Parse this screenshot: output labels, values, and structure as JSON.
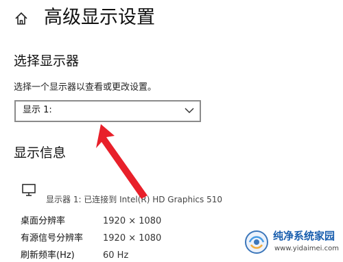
{
  "header": {
    "title": "高级显示设置"
  },
  "select_display": {
    "heading": "选择显示器",
    "description": "选择一个显示器以查看或更改设置。",
    "selected": "显示 1:"
  },
  "display_info": {
    "heading": "显示信息",
    "monitor_line": "显示器 1: 已连接到 Intel(R) HD Graphics 510",
    "rows": [
      {
        "label": "桌面分辨率",
        "value": "1920 × 1080"
      },
      {
        "label": "有源信号分辨率",
        "value": "1920 × 1080"
      },
      {
        "label": "刷新频率(Hz)",
        "value": "60 Hz"
      }
    ]
  },
  "watermark": {
    "text": "纯净系统家园",
    "url": "www.yidaimei.com"
  },
  "colors": {
    "arrow": "#e8202a",
    "watermark": "#1a5fae"
  },
  "icons": [
    "home-icon",
    "chevron-down-icon",
    "monitor-icon"
  ]
}
